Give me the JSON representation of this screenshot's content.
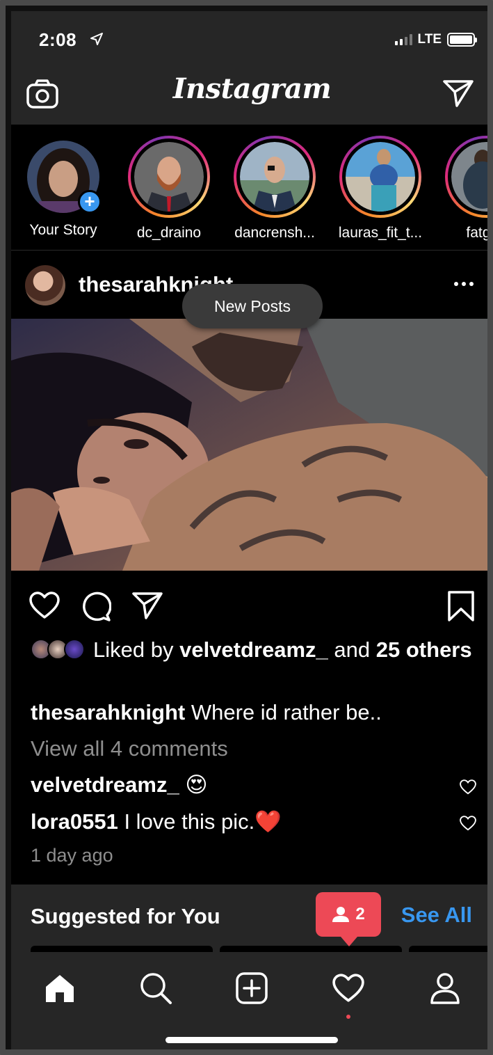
{
  "status": {
    "time": "2:08",
    "network": "LTE"
  },
  "header": {
    "logo_text": "Instagram"
  },
  "stories": [
    {
      "name": "Your Story"
    },
    {
      "name": "dc_draino"
    },
    {
      "name": "dancrensh..."
    },
    {
      "name": "lauras_fit_t..."
    },
    {
      "name": "fatgirlf"
    }
  ],
  "post": {
    "username": "thesarahknight",
    "new_posts_label": "New Posts",
    "likes_prefix": "Liked by",
    "likes_user": "velvetdreamz_",
    "likes_and": "and",
    "likes_count": "25",
    "likes_others": "others",
    "caption_user": "thesarahknight",
    "caption_text": "Where id rather be..",
    "view_all": "View all 4 comments",
    "comments": [
      {
        "user": "velvetdreamz_",
        "text": "😍"
      },
      {
        "user": "lora0551",
        "text": "I love this pic.❤️"
      }
    ],
    "time_ago": "1 day ago"
  },
  "suggested": {
    "title": "Suggested for You",
    "see_all": "See All"
  },
  "notification": {
    "count": "2"
  },
  "colors": {
    "accent": "#3897f0",
    "notification": "#ed4956",
    "bar": "#262626"
  }
}
